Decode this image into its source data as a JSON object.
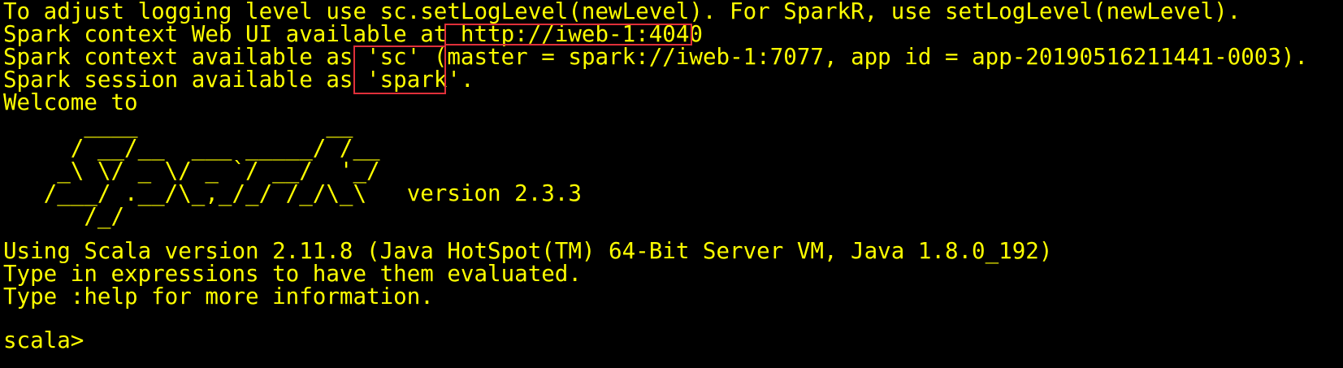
{
  "terminal": {
    "colors": {
      "background": "#000000",
      "text": "#ffff00",
      "highlight_border": "#e0303a"
    },
    "lines": {
      "log_level": "To adjust logging level use sc.setLogLevel(newLevel). For SparkR, use setLogLevel(newLevel).",
      "webui_prefix": "Spark context Web UI available at ",
      "webui_url": "http://iweb-1:4040",
      "context_prefix": "Spark context available as ",
      "context_name": "'sc'",
      "context_suffix": " (master = spark://iweb-1:7077, app id = app-20190516211441-0003).",
      "session_prefix": "Spark session available as ",
      "session_name": "'spark'",
      "session_suffix": ".",
      "welcome": "Welcome to",
      "banner_1": "      ____              __",
      "banner_2": "     / __/__  ___ _____/ /__",
      "banner_3": "    _\\ \\/ _ \\/ _ `/ __/  '_/",
      "banner_4": "   /___/ .__/\\_,_/_/ /_/\\_\\   version 2.3.3",
      "banner_5": "      /_/",
      "scala_version": "Using Scala version 2.11.8 (Java HotSpot(TM) 64-Bit Server VM, Java 1.8.0_192)",
      "type_expr": "Type in expressions to have them evaluated.",
      "type_help": "Type :help for more information.",
      "prompt": "scala>"
    }
  }
}
